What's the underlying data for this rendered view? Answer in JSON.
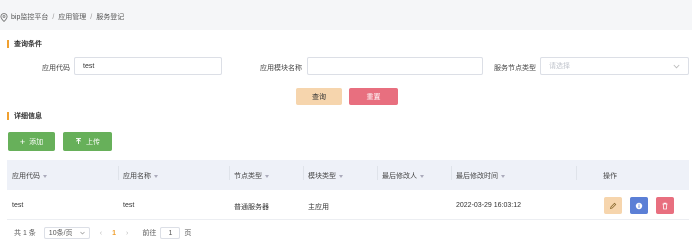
{
  "breadcrumb": [
    "bip监控平台",
    "应用管理",
    "服务登记"
  ],
  "query_section": {
    "title": "查询条件",
    "fields": [
      {
        "label": "应用代码",
        "value": "test",
        "placeholder": ""
      },
      {
        "label": "应用模块名称",
        "value": "",
        "placeholder": ""
      },
      {
        "label": "服务节点类型",
        "value": "",
        "placeholder": "请选择"
      }
    ],
    "query_button": "查询",
    "reset_button": "重置"
  },
  "detail_section": {
    "title": "详细信息",
    "add_button": "添加",
    "upload_button": "上传"
  },
  "table": {
    "columns": [
      "应用代码",
      "应用名称",
      "节点类型",
      "模块类型",
      "最后修改人",
      "最后修改时间",
      "操作"
    ],
    "rows": [
      {
        "app_code": "test",
        "app_name": "test",
        "node_type": "普通服务器",
        "module_type": "主应用",
        "modifier": "",
        "modified_time": "2022-03-29 16:03:12"
      }
    ]
  },
  "pagination": {
    "total": "共 1 条",
    "page_size": "10条/页",
    "current_page": "1",
    "goto_label": "前往",
    "goto_value": "1",
    "page_unit": "页"
  },
  "colors": {
    "accent": "#f0a030",
    "reset": "#e86f7f",
    "query": "#f6d5ad",
    "green": "#67b05a",
    "info": "#5b7fd6"
  }
}
